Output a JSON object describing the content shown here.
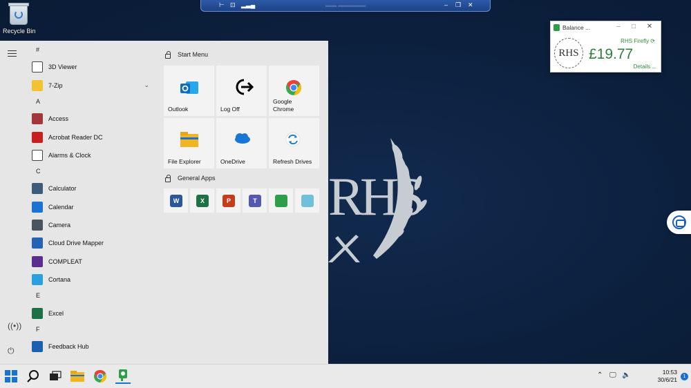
{
  "desktop": {
    "recycle_bin_label": "Recycle Bin"
  },
  "balance_widget": {
    "title": "Balance ...",
    "account": "RHS Firefly",
    "amount": "£19.77",
    "details_link": "Details ...",
    "seal_text": "RHS"
  },
  "wallpaper": {
    "monogram": "RHS"
  },
  "start_menu": {
    "groups": [
      {
        "letter": "#",
        "apps": [
          {
            "label": "3D Viewer",
            "icon": "cube-icon",
            "color": "#ffffff"
          },
          {
            "label": "7-Zip",
            "icon": "folder-icon",
            "color": "#f2c230",
            "expandable": true
          }
        ]
      },
      {
        "letter": "A",
        "apps": [
          {
            "label": "Access",
            "icon": "access-icon",
            "color": "#a4373a"
          },
          {
            "label": "Acrobat Reader DC",
            "icon": "acrobat-icon",
            "color": "#c8201e"
          },
          {
            "label": "Alarms & Clock",
            "icon": "clock-icon",
            "color": "#ffffff"
          }
        ]
      },
      {
        "letter": "C",
        "apps": [
          {
            "label": "Calculator",
            "icon": "calculator-icon",
            "color": "#3b5d7a"
          },
          {
            "label": "Calendar",
            "icon": "calendar-icon",
            "color": "#1a73d1"
          },
          {
            "label": "Camera",
            "icon": "camera-icon",
            "color": "#4a5560"
          },
          {
            "label": "Cloud Drive Mapper",
            "icon": "cloud-drive-mapper-icon",
            "color": "#2462b8"
          },
          {
            "label": "COMPLEAT",
            "icon": "compleat-icon",
            "color": "#5a2d91"
          },
          {
            "label": "Cortana",
            "icon": "cortana-icon",
            "color": "#2aa0e0"
          }
        ]
      },
      {
        "letter": "E",
        "apps": [
          {
            "label": "Excel",
            "icon": "excel-icon",
            "color": "#1e7145"
          }
        ]
      },
      {
        "letter": "F",
        "apps": [
          {
            "label": "Feedback Hub",
            "icon": "feedback-hub-icon",
            "color": "#1d5fb0"
          }
        ]
      }
    ],
    "sections": [
      {
        "title": "Start Menu",
        "tiles": [
          {
            "label": "Outlook",
            "icon": "outlook-icon",
            "color": "#0f6cbd"
          },
          {
            "label": "Log Off",
            "icon": "log-off-icon",
            "color": "#000000"
          },
          {
            "label": "Google Chrome",
            "icon": "chrome-icon",
            "color": "#ea4335"
          },
          {
            "label": "File Explorer",
            "icon": "file-explorer-icon",
            "color": "#f2b522"
          },
          {
            "label": "OneDrive",
            "icon": "onedrive-icon",
            "color": "#1877d4"
          },
          {
            "label": "Refresh Drives",
            "icon": "refresh-icon",
            "color": "#1f7fd8"
          }
        ]
      },
      {
        "title": "General Apps",
        "small_tiles": [
          {
            "icon": "word-icon",
            "color": "#2b579a",
            "glyph": "W"
          },
          {
            "icon": "excel-icon",
            "color": "#1e7145",
            "glyph": "X"
          },
          {
            "icon": "powerpoint-icon",
            "color": "#c43e1c",
            "glyph": "P"
          },
          {
            "icon": "teams-icon",
            "color": "#5558af",
            "glyph": "T"
          },
          {
            "icon": "firefly-icon",
            "color": "#2e9e4a",
            "glyph": ""
          },
          {
            "icon": "eraser-icon",
            "color": "#6ec1d9",
            "glyph": ""
          }
        ]
      }
    ]
  },
  "taskbar": {
    "time": "10:53",
    "date": "30/6/21",
    "notification_count": "1"
  }
}
